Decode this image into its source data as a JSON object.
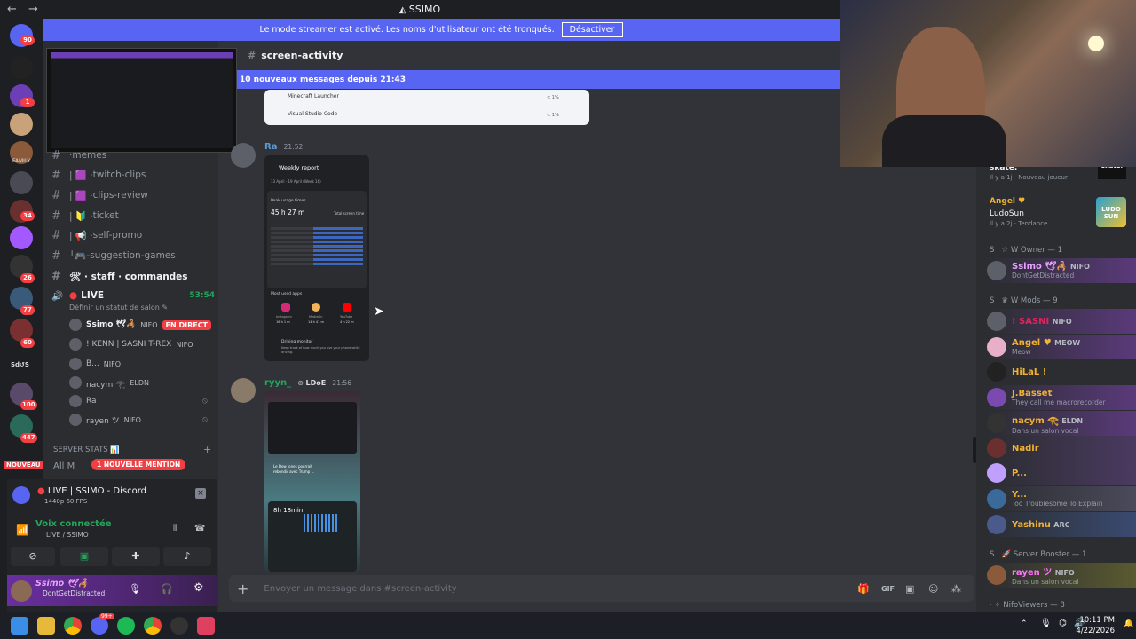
{
  "window": {
    "title": "SSIMO",
    "back": "←",
    "forward": "→"
  },
  "banner": {
    "text": "Le mode streamer est activé. Les noms d'utilisateur ont été tronqués.",
    "button": "Désactiver"
  },
  "guild_badges": {
    "b1": "90",
    "b2": "1",
    "b3": "34",
    "b4": "26",
    "b5": "77",
    "b6": "60",
    "b7": "100",
    "b8": "447",
    "family": "FAMILY",
    "sdvs": "Sd↺S"
  },
  "nouveau": "NOUVEAU",
  "channels": [
    {
      "name": "memes",
      "prefix": "· "
    },
    {
      "name": "twitch-clips",
      "prefix": "| 🟪 · "
    },
    {
      "name": "clips-review",
      "prefix": "| 🟪 · "
    },
    {
      "name": "ticket",
      "prefix": "| 🔰 · "
    },
    {
      "name": "self-promo",
      "prefix": "| 📢 · "
    },
    {
      "name": "-suggestion-games",
      "prefix": "└🎮"
    }
  ],
  "staff_channel": "🛠 · staff · commandes",
  "voice": {
    "name": "LIVE",
    "timer": "53:54",
    "status_hint": "Définir un statut de salon ✎"
  },
  "voice_users": [
    {
      "name": "Ssimo 🕊🦂",
      "tag": "NIFO",
      "live": "EN DIRECT"
    },
    {
      "name": "! KENN | SASNI T-REX",
      "tag": "NIFO"
    },
    {
      "name": "B...",
      "tag": "NIFO"
    },
    {
      "name": "nacym 𓂀",
      "tag": "ELDN"
    },
    {
      "name": "Ra",
      "tag": ""
    },
    {
      "name": "rayen ツ",
      "tag": "NIFO"
    }
  ],
  "server_stats": {
    "label": "SERVER STATS 📊",
    "all_m": "All M",
    "mention": "1 NOUVELLE MENTION"
  },
  "stream_panel": {
    "title": "LIVE | SSIMO - Discord",
    "quality": "1440p 60 FPS"
  },
  "voice_panel": {
    "title": "Voix connectée",
    "sub": "LIVE / SSIMO"
  },
  "user": {
    "name": "Ssimo 🕊🦂",
    "status": "DontGetDistracted"
  },
  "chat": {
    "channel": "screen-activity",
    "new_messages": "10 nouveaux messages depuis 21:43",
    "embed_top": {
      "app1": "Minecraft Launcher",
      "app2": "Visual Studio Code",
      "pct": "< 1%"
    },
    "msg1": {
      "author": "Ra",
      "time": "21:52"
    },
    "report": {
      "title": "Weekly report",
      "range": "13 April - 19 April (Week 16)",
      "peak": "Peak usage times",
      "total": "45 h 27 m",
      "total_label": "Total screen time",
      "most_used": "Most used apps",
      "apps": [
        {
          "name": "Instagram",
          "t": "16 h 1 m"
        },
        {
          "name": "MediaOn",
          "t": "14 h 41 m"
        },
        {
          "name": "YouTube",
          "t": "4 h 22 m"
        }
      ],
      "driving": "Driving monitor",
      "driving_sub": "Keep track of how much you use your phone while driving."
    },
    "msg2": {
      "author": "ryyn_",
      "tag": "LDoE",
      "time": "21:56"
    },
    "phone2": {
      "screen_time": "8h 18min",
      "news": "Le Dow Jones pourrait rebondir avec Trump ..."
    },
    "composer_placeholder": "Envoyer un message dans #screen-activity"
  },
  "members": {
    "top": {
      "name": "skate.",
      "sub": "Il y a 1j · Nouveau joueur",
      "badge": "skate."
    },
    "angel_top": {
      "name": "Angel ♥",
      "game": "LudoSun",
      "sub": "Il y a 2j · Tendance",
      "badge": "LUDO SUN"
    },
    "sections": [
      "S · ☆ W Owner — 1",
      "S · ♛ W Mods — 9",
      "S · 🚀 Server Booster — 1",
      "· ✧ NifoViewers — 8"
    ],
    "owner": {
      "name": "Ssimo 🕊🦂",
      "tag": "NIFO",
      "status": "DontGetDistracted"
    },
    "mods": [
      {
        "name": "! SASNI",
        "tag": "NIFO",
        "status": "",
        "color": "#e0245e"
      },
      {
        "name": "Angel ♥",
        "tag": "MEOW",
        "status": "Meow",
        "color": "#f0b232"
      },
      {
        "name": "HiLaL !",
        "tag": "",
        "status": "",
        "color": "#f0b232"
      },
      {
        "name": "J.Basset",
        "tag": "",
        "status": "They call me macrorecorder",
        "color": "#f0b232"
      },
      {
        "name": "nacym 𓂀",
        "tag": "ELDN",
        "status": "Dans un salon vocal",
        "color": "#f0b232"
      },
      {
        "name": "Nadir",
        "tag": "",
        "status": "",
        "color": "#f0b232"
      },
      {
        "name": "P...",
        "tag": "",
        "status": "",
        "color": "#f0b232"
      },
      {
        "name": "Y...",
        "tag": "",
        "status": "Too Troublesome To Explain",
        "color": "#f0b232"
      },
      {
        "name": "Yashinu",
        "tag": "ARC",
        "status": "",
        "color": "#f0b232"
      }
    ],
    "booster": {
      "name": "rayen ツ",
      "tag": "NIFO",
      "status": "Dans un salon vocal"
    }
  },
  "taskbar": {
    "time": "10:11 PM",
    "date": "4/22/2026",
    "chrome_badge": "99+"
  },
  "colors": {
    "blurple": "#5865f2",
    "red": "#f23f43",
    "green": "#23a55a",
    "mod_gold": "#f0b232"
  }
}
